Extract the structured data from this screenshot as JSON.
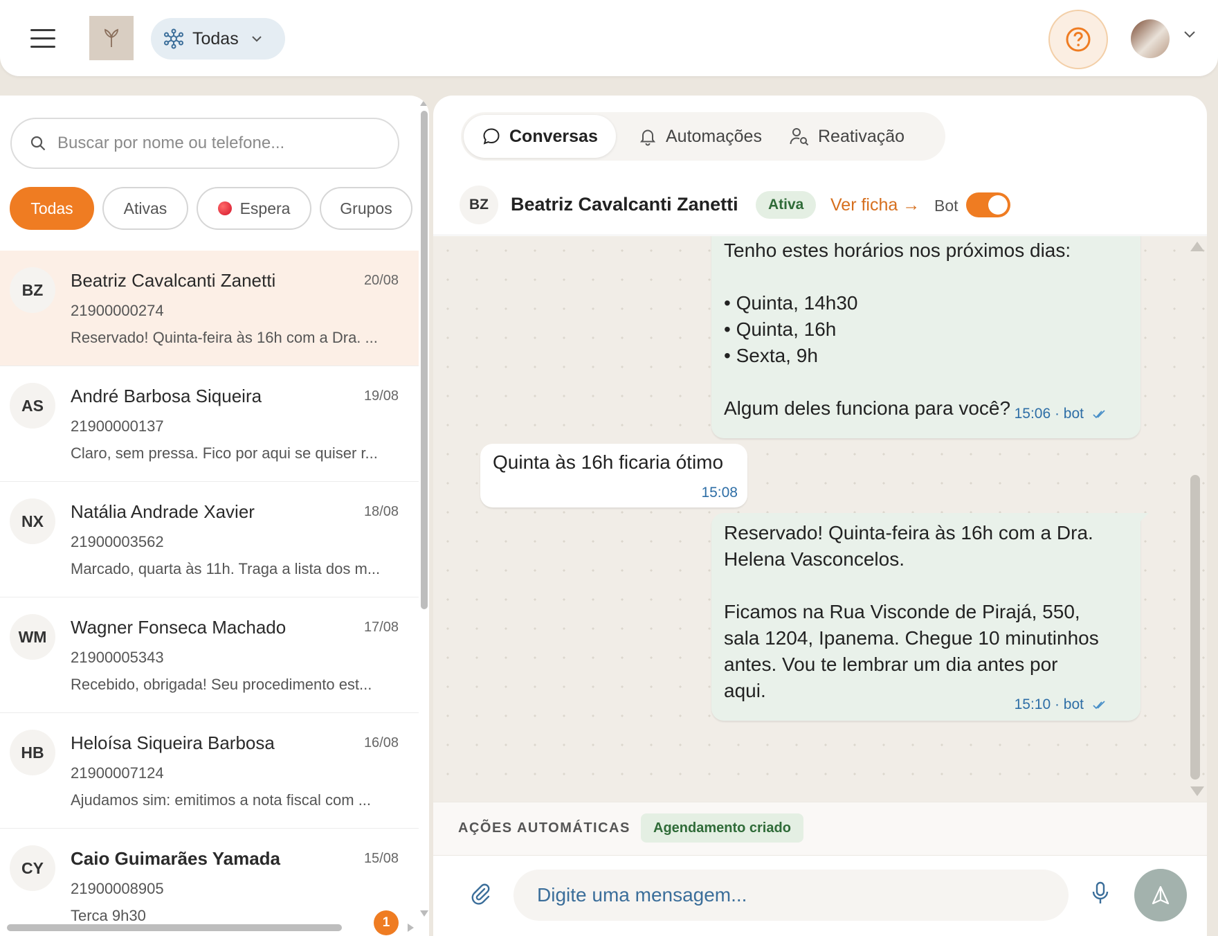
{
  "header": {
    "unit_label": "Todas"
  },
  "sidebar": {
    "search_placeholder": "Buscar por nome ou telefone...",
    "filters": [
      "Todas",
      "Ativas",
      "Espera",
      "Grupos"
    ],
    "conversations": [
      {
        "initials": "BZ",
        "name": "Beatriz Cavalcanti Zanetti",
        "date": "20/08",
        "phone": "21900000274",
        "preview": "Reservado! Quinta-feira às 16h com a Dra. ..."
      },
      {
        "initials": "AS",
        "name": "André Barbosa Siqueira",
        "date": "19/08",
        "phone": "21900000137",
        "preview": "Claro, sem pressa. Fico por aqui se quiser r..."
      },
      {
        "initials": "NX",
        "name": "Natália Andrade Xavier",
        "date": "18/08",
        "phone": "21900003562",
        "preview": "Marcado, quarta às 11h. Traga a lista dos m..."
      },
      {
        "initials": "WM",
        "name": "Wagner Fonseca Machado",
        "date": "17/08",
        "phone": "21900005343",
        "preview": "Recebido, obrigada! Seu procedimento est..."
      },
      {
        "initials": "HB",
        "name": "Heloísa Siqueira Barbosa",
        "date": "16/08",
        "phone": "21900007124",
        "preview": "Ajudamos sim: emitimos a nota fiscal com ..."
      },
      {
        "initials": "CY",
        "name": "Caio Guimarães Yamada",
        "date": "15/08",
        "phone": "21900008905",
        "preview": "Terca 9h30",
        "unread": "1"
      }
    ]
  },
  "tabs": [
    "Conversas",
    "Automações",
    "Reativação"
  ],
  "chat": {
    "initials": "BZ",
    "name": "Beatriz Cavalcanti Zanetti",
    "status": "Ativa",
    "ver_ficha": "Ver ficha →",
    "bot_label": "Bot",
    "messages": [
      {
        "direction": "out",
        "text": "Tenho estes horários nos próximos dias:\n\n• Quinta, 14h30\n• Quinta, 16h\n• Sexta, 9h\n\nAlgum deles funciona para você?",
        "meta": "15:06 · bot"
      },
      {
        "direction": "in",
        "text": "Quinta às 16h ficaria ótimo",
        "meta": "15:08"
      },
      {
        "direction": "out",
        "text": "Reservado! Quinta-feira às 16h com a Dra.\nHelena Vasconcelos.\n\nFicamos na Rua Visconde de Pirajá, 550,\nsala 1204, Ipanema. Chegue 10 minutinhos\nantes. Vou te lembrar um dia antes por\naqui.",
        "meta": "15:10 · bot"
      }
    ],
    "actions_label": "AÇÕES AUTOMÁTICAS",
    "action_chip": "Agendamento criado",
    "input_placeholder": "Digite uma mensagem..."
  }
}
